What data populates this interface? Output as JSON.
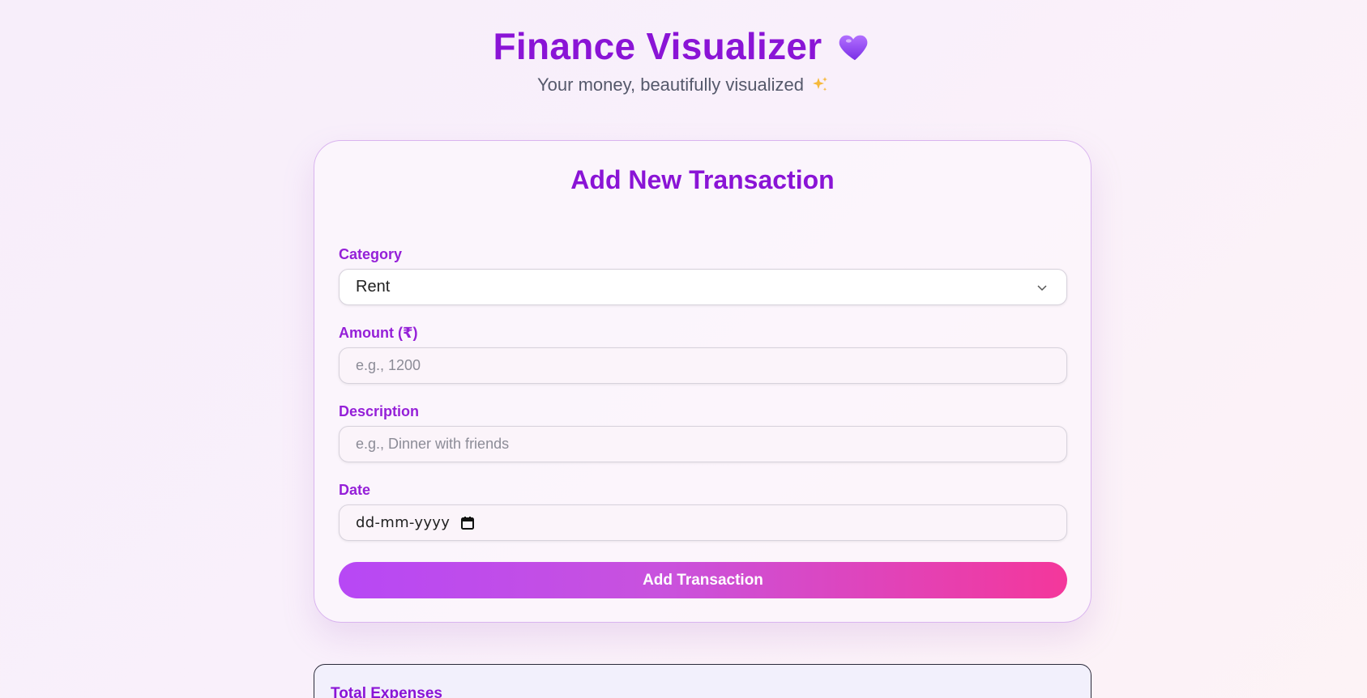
{
  "header": {
    "title": "Finance Visualizer",
    "subtitle": "Your money, beautifully visualized",
    "title_icon": "purple-heart-icon",
    "subtitle_icon": "sparkles-icon"
  },
  "form": {
    "title": "Add New Transaction",
    "category": {
      "label": "Category",
      "value": "Rent"
    },
    "amount": {
      "label": "Amount (₹)",
      "placeholder": "e.g., 1200",
      "value": ""
    },
    "description": {
      "label": "Description",
      "placeholder": "e.g., Dinner with friends",
      "value": ""
    },
    "date": {
      "label": "Date",
      "placeholder": "dd-mm-yyyy"
    },
    "submit_label": "Add Transaction"
  },
  "summary": {
    "title": "Total Expenses"
  },
  "colors": {
    "accent": "#8a14d6",
    "button_start": "#b748f5",
    "button_end": "#f4379b"
  }
}
